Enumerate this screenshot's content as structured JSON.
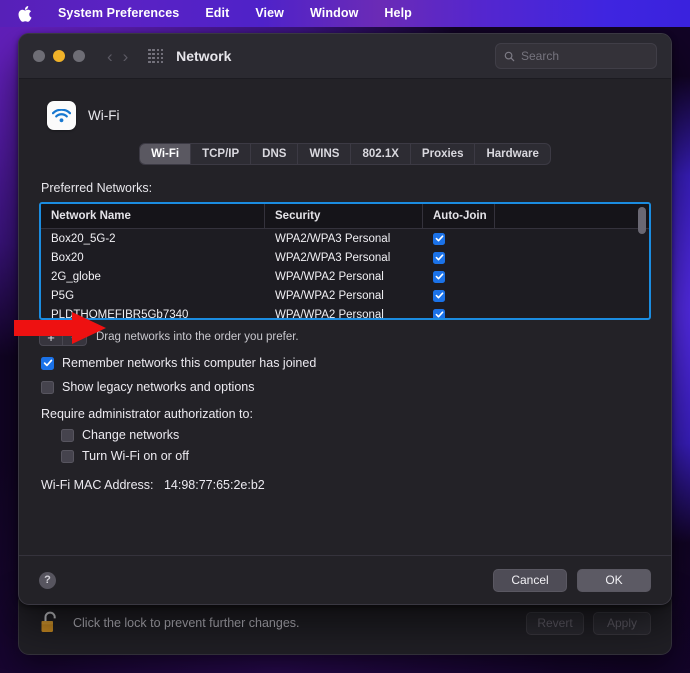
{
  "menubar": {
    "apple_icon": "apple-logo-icon",
    "items": [
      {
        "label": "System Preferences",
        "bold": true
      },
      {
        "label": "Edit"
      },
      {
        "label": "View"
      },
      {
        "label": "Window"
      },
      {
        "label": "Help"
      }
    ]
  },
  "window": {
    "title": "Network",
    "traffic_lights": [
      "close",
      "minimize",
      "zoom"
    ],
    "nav": {
      "back": "‹",
      "forward": "›"
    },
    "grid_icon": "grid-view-icon",
    "search": {
      "placeholder": "Search",
      "value": "",
      "icon": "search-icon"
    }
  },
  "service": {
    "icon": "wifi-icon",
    "name": "Wi-Fi"
  },
  "tabs": [
    {
      "label": "Wi-Fi",
      "active": true
    },
    {
      "label": "TCP/IP",
      "active": false
    },
    {
      "label": "DNS",
      "active": false
    },
    {
      "label": "WINS",
      "active": false
    },
    {
      "label": "802.1X",
      "active": false
    },
    {
      "label": "Proxies",
      "active": false
    },
    {
      "label": "Hardware",
      "active": false
    }
  ],
  "preferred_networks": {
    "label": "Preferred Networks:",
    "highlight_color": "#1b8ce0",
    "columns": [
      "Network Name",
      "Security",
      "Auto-Join"
    ],
    "rows": [
      {
        "name": "Box20_5G-2",
        "security": "WPA2/WPA3 Personal",
        "auto_join": true
      },
      {
        "name": "Box20",
        "security": "WPA2/WPA3 Personal",
        "auto_join": true
      },
      {
        "name": "2G_globe",
        "security": "WPA/WPA2 Personal",
        "auto_join": true
      },
      {
        "name": "P5G",
        "security": "WPA/WPA2 Personal",
        "auto_join": true
      },
      {
        "name": "PLDTHOMEFIBR5Gb7340",
        "security": "WPA/WPA2 Personal",
        "auto_join": true
      },
      {
        "name": "",
        "security": "",
        "auto_join": true
      }
    ],
    "add_button": "+",
    "remove_button": "−",
    "drag_hint": "Drag networks into the order you prefer."
  },
  "options": [
    {
      "label": "Remember networks this computer has joined",
      "checked": true
    },
    {
      "label": "Show legacy networks and options",
      "checked": false
    }
  ],
  "admin": {
    "label": "Require administrator authorization to:",
    "options": [
      {
        "label": "Change networks",
        "checked": false
      },
      {
        "label": "Turn Wi-Fi on or off",
        "checked": false
      }
    ]
  },
  "mac_address": {
    "label": "Wi-Fi MAC Address:",
    "value": "14:98:77:65:2e:b2"
  },
  "footer": {
    "help": "?",
    "cancel": "Cancel",
    "ok": "OK"
  },
  "lockbar": {
    "icon": "unlocked-padlock-icon",
    "text": "Click the lock to prevent further changes.",
    "revert": "Revert",
    "apply": "Apply"
  },
  "annotation": {
    "arrow": "red-arrow-pointing-right",
    "color": "#ee1111",
    "target": "PLDTHOMEFIBR5Gb7340"
  }
}
